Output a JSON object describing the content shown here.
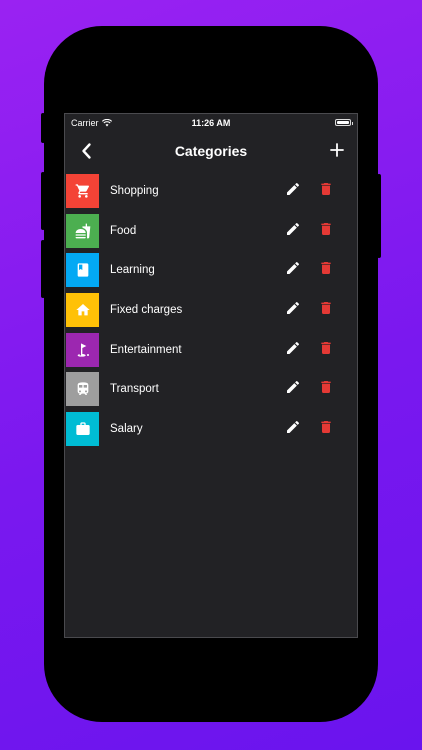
{
  "status_bar": {
    "carrier": "Carrier",
    "time": "11:26 AM"
  },
  "navbar": {
    "title": "Categories",
    "back_icon": "chevron-left-icon",
    "add_icon": "plus-icon"
  },
  "categories": [
    {
      "label": "Shopping",
      "color": "#f44336",
      "icon": "shopping-cart-icon"
    },
    {
      "label": "Food",
      "color": "#4caf50",
      "icon": "fastfood-icon"
    },
    {
      "label": "Learning",
      "color": "#03a9f4",
      "icon": "book-icon"
    },
    {
      "label": "Fixed charges",
      "color": "#ffc107",
      "icon": "home-icon"
    },
    {
      "label": "Entertainment",
      "color": "#9c27b0",
      "icon": "golf-icon"
    },
    {
      "label": "Transport",
      "color": "#9e9e9e",
      "icon": "train-icon"
    },
    {
      "label": "Salary",
      "color": "#00bcd4",
      "icon": "briefcase-icon"
    }
  ],
  "colors": {
    "delete": "#e53935",
    "edit": "#ffffff",
    "background": "#222225",
    "accent_gradient": [
      "#9a22f2",
      "#6a14ee"
    ]
  }
}
